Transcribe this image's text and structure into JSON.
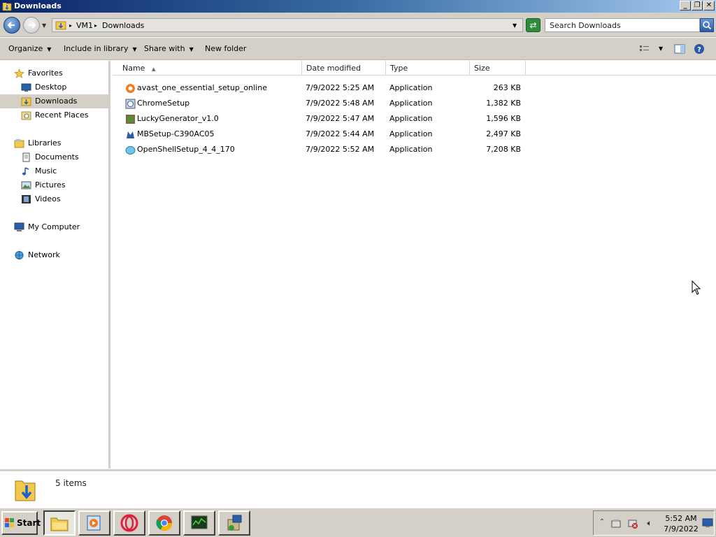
{
  "window": {
    "title": "Downloads"
  },
  "address": {
    "segments": [
      "VM1",
      "Downloads"
    ]
  },
  "search": {
    "placeholder": "Search Downloads"
  },
  "toolbar": {
    "organize": "Organize",
    "include_in_library": "Include in library",
    "share_with": "Share with",
    "new_folder": "New folder"
  },
  "nav": {
    "favorites": "Favorites",
    "desktop": "Desktop",
    "downloads": "Downloads",
    "recent_places": "Recent Places",
    "libraries": "Libraries",
    "documents": "Documents",
    "music": "Music",
    "pictures": "Pictures",
    "videos": "Videos",
    "my_computer": "My Computer",
    "network": "Network"
  },
  "columns": {
    "name": "Name",
    "date": "Date modified",
    "type": "Type",
    "size": "Size"
  },
  "files": [
    {
      "name": "avast_one_essential_setup_online",
      "date": "7/9/2022 5:25 AM",
      "type": "Application",
      "size": "263 KB",
      "icon": "avast-icon"
    },
    {
      "name": "ChromeSetup",
      "date": "7/9/2022 5:48 AM",
      "type": "Application",
      "size": "1,382 KB",
      "icon": "chrome-setup-icon"
    },
    {
      "name": "LuckyGenerator_v1.0",
      "date": "7/9/2022 5:47 AM",
      "type": "Application",
      "size": "1,596 KB",
      "icon": "lucky-generator-icon"
    },
    {
      "name": "MBSetup-C390AC05",
      "date": "7/9/2022 5:44 AM",
      "type": "Application",
      "size": "2,497 KB",
      "icon": "malwarebytes-icon"
    },
    {
      "name": "OpenShellSetup_4_4_170",
      "date": "7/9/2022 5:52 AM",
      "type": "Application",
      "size": "7,208 KB",
      "icon": "openshell-icon"
    }
  ],
  "status": {
    "item_count": "5 items"
  },
  "taskbar": {
    "start": "Start",
    "time": "5:52 AM",
    "date": "7/9/2022"
  },
  "colors": {
    "titlebar_start": "#0a246a",
    "titlebar_end": "#a6caf0",
    "chrome": "#d4d0c8",
    "selected_nav": "#d4d0c8"
  }
}
